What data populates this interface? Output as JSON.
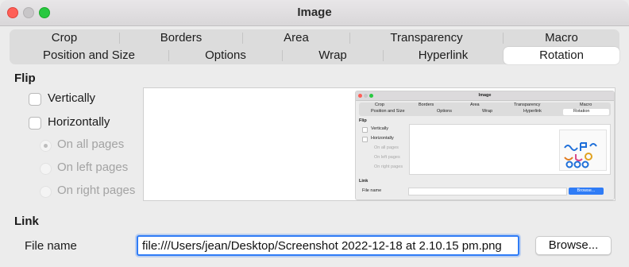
{
  "window": {
    "title": "Image"
  },
  "tabs_row1": [
    "Crop",
    "Borders",
    "Area",
    "Transparency",
    "Macro"
  ],
  "tabs_row2": [
    "Position and Size",
    "Options",
    "Wrap",
    "Hyperlink",
    "Rotation"
  ],
  "selected_tab": "Rotation",
  "flip": {
    "title": "Flip",
    "vertically": "Vertically",
    "horizontally": "Horizontally",
    "on_all_pages": "On all pages",
    "on_left_pages": "On left pages",
    "on_right_pages": "On right pages"
  },
  "link": {
    "title": "Link",
    "file_name_label": "File name",
    "file_name_value": "file:///Users/jean/Desktop/Screenshot 2022-12-18 at 2.10.15 pm.png",
    "browse_label": "Browse..."
  },
  "preview_thumb": {
    "title": "Image",
    "row1": [
      "Crop",
      "Borders",
      "Area",
      "Transparency",
      "Macro"
    ],
    "row2": [
      "Position and Size",
      "Options",
      "Wrap",
      "Hyperlink",
      "Rotation"
    ],
    "flip": "Flip",
    "vertically": "Vertically",
    "horizontally": "Horizontally",
    "on_all_pages": "On all pages",
    "on_left_pages": "On left pages",
    "on_right_pages": "On right pages",
    "link": "Link",
    "file_name": "File name",
    "browse": "Browse..."
  },
  "colors": {
    "accent": "#2f7cf6",
    "close": "#fe5f57",
    "maximize": "#28c840"
  }
}
